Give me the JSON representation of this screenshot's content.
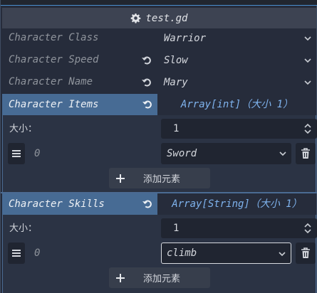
{
  "header": {
    "title": "test.gd",
    "icon": "gear-icon"
  },
  "properties": [
    {
      "label": "Character Class",
      "value": "Warrior",
      "has_revert": false
    },
    {
      "label": "Character Speed",
      "value": "Slow",
      "has_revert": true
    },
    {
      "label": "Character Name",
      "value": "Mary",
      "has_revert": true
    }
  ],
  "items_array": {
    "label": "Character Items",
    "type": "Array[int]（大小 1）",
    "size_label": "大小：",
    "size_value": "1",
    "elements": [
      {
        "index": "0",
        "value": "Sword"
      }
    ],
    "add_label": "添加元素"
  },
  "skills_array": {
    "label": "Character Skills",
    "type": "Array[String]（大小 1）",
    "size_label": "大小：",
    "size_value": "1",
    "elements": [
      {
        "index": "0",
        "value": "climb"
      }
    ],
    "add_label": "添加元素"
  },
  "colors": {
    "background": "#262c3b",
    "array_header": "#476b94",
    "type_text": "#7fb3ee",
    "field_bg": "#202531"
  }
}
